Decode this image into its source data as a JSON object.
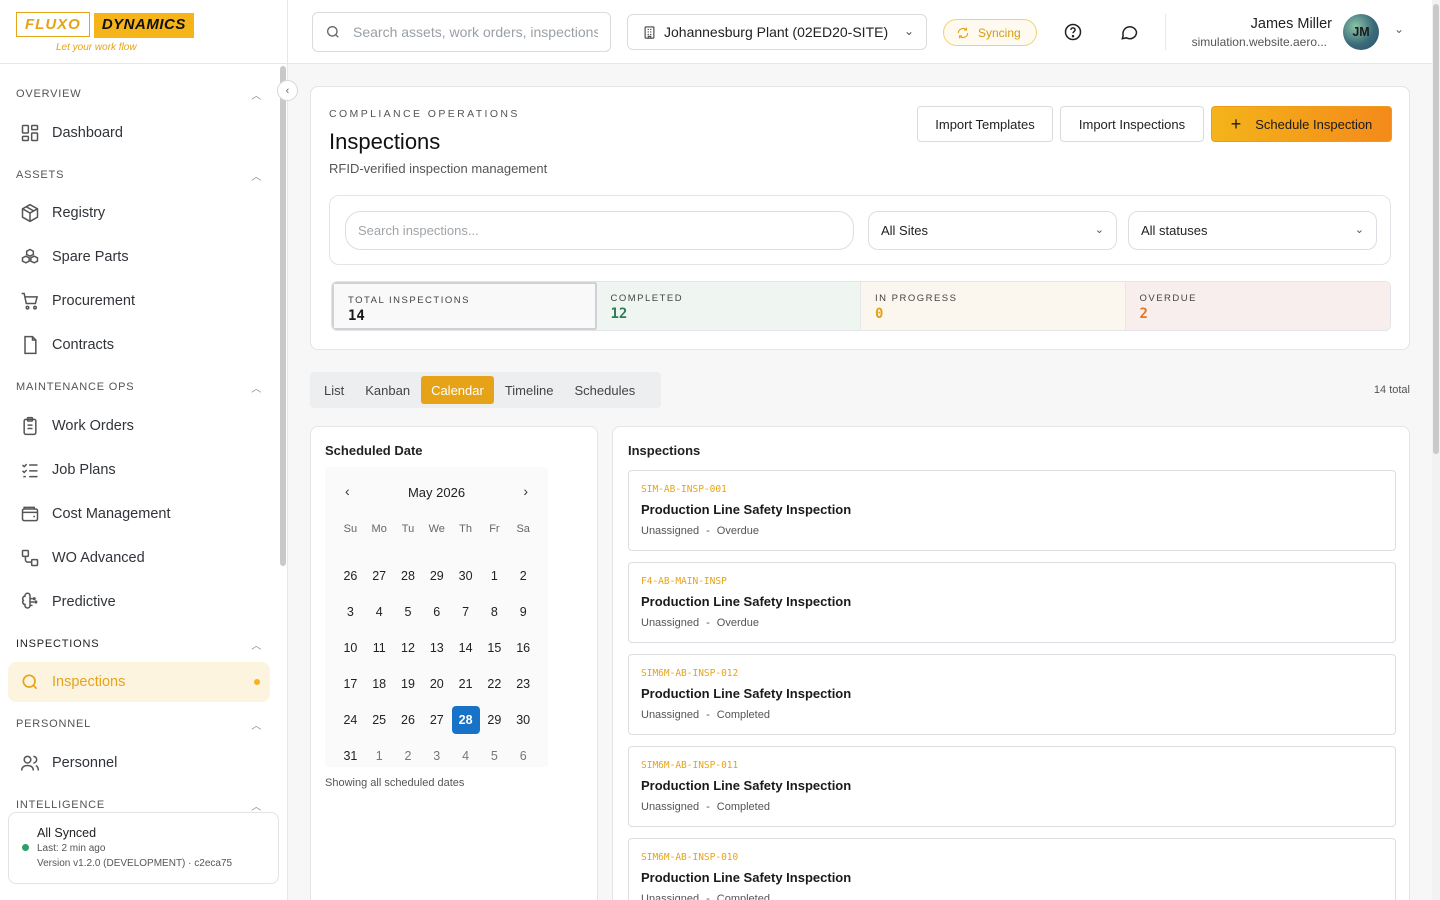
{
  "brand": {
    "word1": "FLUXO",
    "word2": "DYNAMICS",
    "tagline": "Let your work flow",
    "accent": "#e6a317"
  },
  "sidebar": {
    "sections": [
      {
        "label": "OVERVIEW",
        "items": [
          {
            "label": "Dashboard",
            "icon": "dashboard-icon"
          }
        ]
      },
      {
        "label": "ASSETS",
        "items": [
          {
            "label": "Registry",
            "icon": "box-icon"
          },
          {
            "label": "Spare Parts",
            "icon": "boxes-icon"
          },
          {
            "label": "Procurement",
            "icon": "cart-icon"
          },
          {
            "label": "Contracts",
            "icon": "document-icon"
          }
        ]
      },
      {
        "label": "MAINTENANCE OPS",
        "items": [
          {
            "label": "Work Orders",
            "icon": "clipboard-icon"
          },
          {
            "label": "Job Plans",
            "icon": "list-check-icon"
          },
          {
            "label": "Cost Management",
            "icon": "wallet-icon"
          },
          {
            "label": "WO Advanced",
            "icon": "workflow-icon"
          },
          {
            "label": "Predictive",
            "icon": "brain-icon"
          }
        ]
      },
      {
        "label": "INSPECTIONS",
        "items": [
          {
            "label": "Inspections",
            "icon": "search-icon",
            "active": true
          }
        ]
      },
      {
        "label": "PERSONNEL",
        "items": [
          {
            "label": "Personnel",
            "icon": "users-icon"
          }
        ]
      },
      {
        "label": "INTELLIGENCE",
        "items": []
      }
    ],
    "sync": {
      "status": "All Synced",
      "last": "Last: 2 min ago",
      "version": "Version v1.2.0 (DEVELOPMENT) · c2eca75"
    }
  },
  "header": {
    "search_placeholder": "Search assets, work orders, inspections...",
    "site": "Johannesburg Plant (02ED20-SITE)",
    "sync_label": "Syncing",
    "user": {
      "name": "James Miller",
      "email": "simulation.website.aero...",
      "initials": "JM"
    }
  },
  "page": {
    "eyebrow": "COMPLIANCE OPERATIONS",
    "title": "Inspections",
    "subtitle": "RFID-verified inspection management",
    "actions": {
      "import_templates": "Import Templates",
      "import_inspections": "Import Inspections",
      "schedule": "Schedule Inspection"
    },
    "filters": {
      "search_placeholder": "Search inspections...",
      "site": "All Sites",
      "status": "All statuses"
    },
    "stats": [
      {
        "label": "TOTAL INSPECTIONS",
        "value": "14",
        "color": "#1a1a1a"
      },
      {
        "label": "COMPLETED",
        "value": "12",
        "color": "#2e7d5b"
      },
      {
        "label": "IN PROGRESS",
        "value": "0",
        "color": "#e6a317"
      },
      {
        "label": "OVERDUE",
        "value": "2",
        "color": "#e8761a"
      }
    ],
    "tabs": [
      "List",
      "Kanban",
      "Calendar",
      "Timeline",
      "Schedules"
    ],
    "active_tab": "Calendar",
    "total_label": "14 total"
  },
  "calendar": {
    "title": "Scheduled Date",
    "month": "May 2026",
    "weekdays": [
      "Su",
      "Mo",
      "Tu",
      "We",
      "Th",
      "Fr",
      "Sa"
    ],
    "days": [
      "26",
      "27",
      "28",
      "29",
      "30",
      "1",
      "2",
      "3",
      "4",
      "5",
      "6",
      "7",
      "8",
      "9",
      "10",
      "11",
      "12",
      "13",
      "14",
      "15",
      "16",
      "17",
      "18",
      "19",
      "20",
      "21",
      "22",
      "23",
      "24",
      "25",
      "26",
      "27",
      "28",
      "29",
      "30",
      "31",
      "1",
      "2",
      "3",
      "4",
      "5",
      "6"
    ],
    "muted_indices": [
      36,
      37,
      38,
      39,
      40,
      41
    ],
    "selected_index": 32,
    "note": "Showing all scheduled dates"
  },
  "inspections": {
    "title": "Inspections",
    "items": [
      {
        "code": "SIM-AB-INSP-001",
        "name": "Production Line Safety Inspection",
        "assignee": "Unassigned",
        "status": "Overdue"
      },
      {
        "code": "F4-AB-MAIN-INSP",
        "name": "Production Line Safety Inspection",
        "assignee": "Unassigned",
        "status": "Overdue"
      },
      {
        "code": "SIM6M-AB-INSP-012",
        "name": "Production Line Safety Inspection",
        "assignee": "Unassigned",
        "status": "Completed"
      },
      {
        "code": "SIM6M-AB-INSP-011",
        "name": "Production Line Safety Inspection",
        "assignee": "Unassigned",
        "status": "Completed"
      },
      {
        "code": "SIM6M-AB-INSP-010",
        "name": "Production Line Safety Inspection",
        "assignee": "Unassigned",
        "status": "Completed"
      }
    ]
  }
}
